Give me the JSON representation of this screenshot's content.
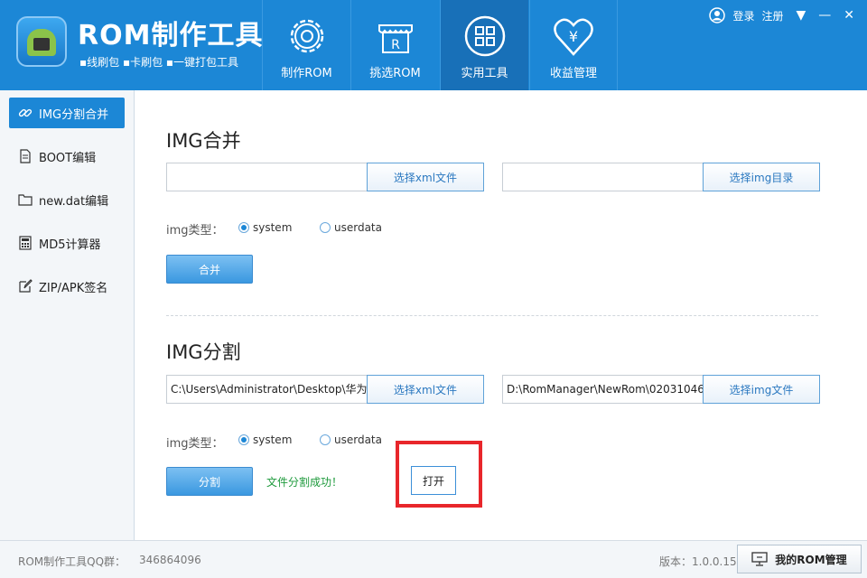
{
  "header": {
    "title": "ROM制作工具",
    "subtitle": "▪线刷包  ▪卡刷包  ▪一键打包工具",
    "nav": [
      {
        "label": "制作ROM",
        "icon": "gear-icon"
      },
      {
        "label": "挑选ROM",
        "icon": "store-icon"
      },
      {
        "label": "实用工具",
        "icon": "grid-icon"
      },
      {
        "label": "收益管理",
        "icon": "heart-yen-icon"
      }
    ],
    "login": "登录",
    "register": "注册"
  },
  "sidebar": {
    "items": [
      {
        "label": "IMG分割合并",
        "icon": "link-icon"
      },
      {
        "label": "BOOT编辑",
        "icon": "document-icon"
      },
      {
        "label": "new.dat编辑",
        "icon": "folder-icon"
      },
      {
        "label": "MD5计算器",
        "icon": "calculator-icon"
      },
      {
        "label": "ZIP/APK签名",
        "icon": "edit-icon"
      }
    ]
  },
  "merge": {
    "title": "IMG合并",
    "xml_value": "",
    "xml_button": "选择xml文件",
    "img_value": "",
    "img_button": "选择img目录",
    "type_label": "img类型：",
    "options": [
      "system",
      "userdata"
    ],
    "selected": "system",
    "action": "合并"
  },
  "split": {
    "title": "IMG分割",
    "xml_value": "C:\\Users\\Administrator\\Desktop\\华为",
    "xml_button": "选择xml文件",
    "img_value": "D:\\RomManager\\NewRom\\02031046",
    "img_button": "选择img文件",
    "type_label": "img类型：",
    "options": [
      "system",
      "userdata"
    ],
    "selected": "system",
    "action": "分割",
    "success": "文件分割成功！",
    "open": "打开"
  },
  "footer": {
    "qq_label": "ROM制作工具QQ群：",
    "qq_number": "346864096",
    "version": "版本：1.0.0.15",
    "my_rom": "我的ROM管理"
  },
  "colors": {
    "header_bg": "#1c87d6",
    "active_nav": "#1870b8",
    "success": "#1e9a3c",
    "highlight": "#e8262b"
  }
}
